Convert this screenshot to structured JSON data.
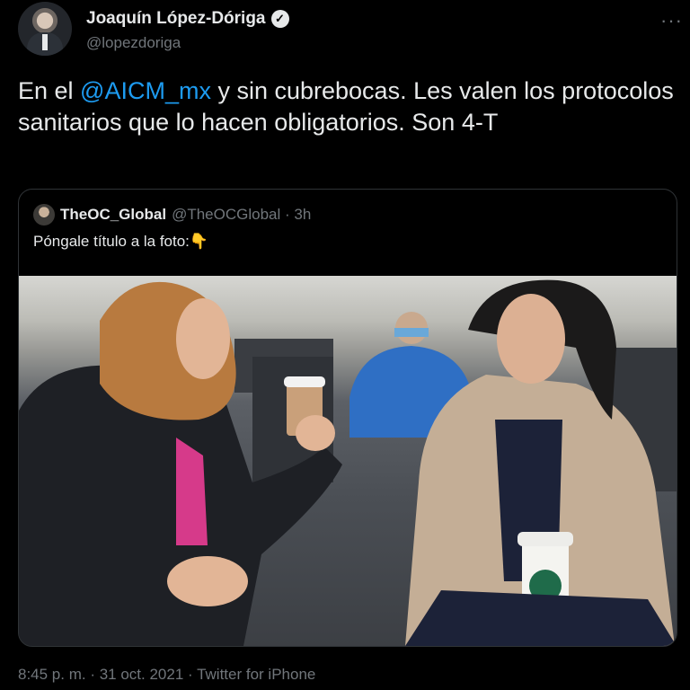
{
  "author": {
    "name": "Joaquín López-Dóriga",
    "handle": "@lopezdoriga",
    "verified_icon": "verified-badge-icon"
  },
  "more_icon": "···",
  "tweet": {
    "text_before": "En el ",
    "mention": "@AICM_mx",
    "text_after": " y sin cubrebocas. Les valen los protocolos sanitarios que lo hacen obligatorios. Son 4-T"
  },
  "quoted": {
    "name": "TheOC_Global",
    "handle_time": "@TheOCGlobal · 3h",
    "text": "Póngale título a la foto:👇"
  },
  "footer": "8:45 p. m. · 31 oct. 2021 · Twitter for iPhone",
  "colors": {
    "background": "#000000",
    "text": "#e7e9ea",
    "secondary": "#71767b",
    "link": "#1d9bf0",
    "border": "#2f3336"
  }
}
